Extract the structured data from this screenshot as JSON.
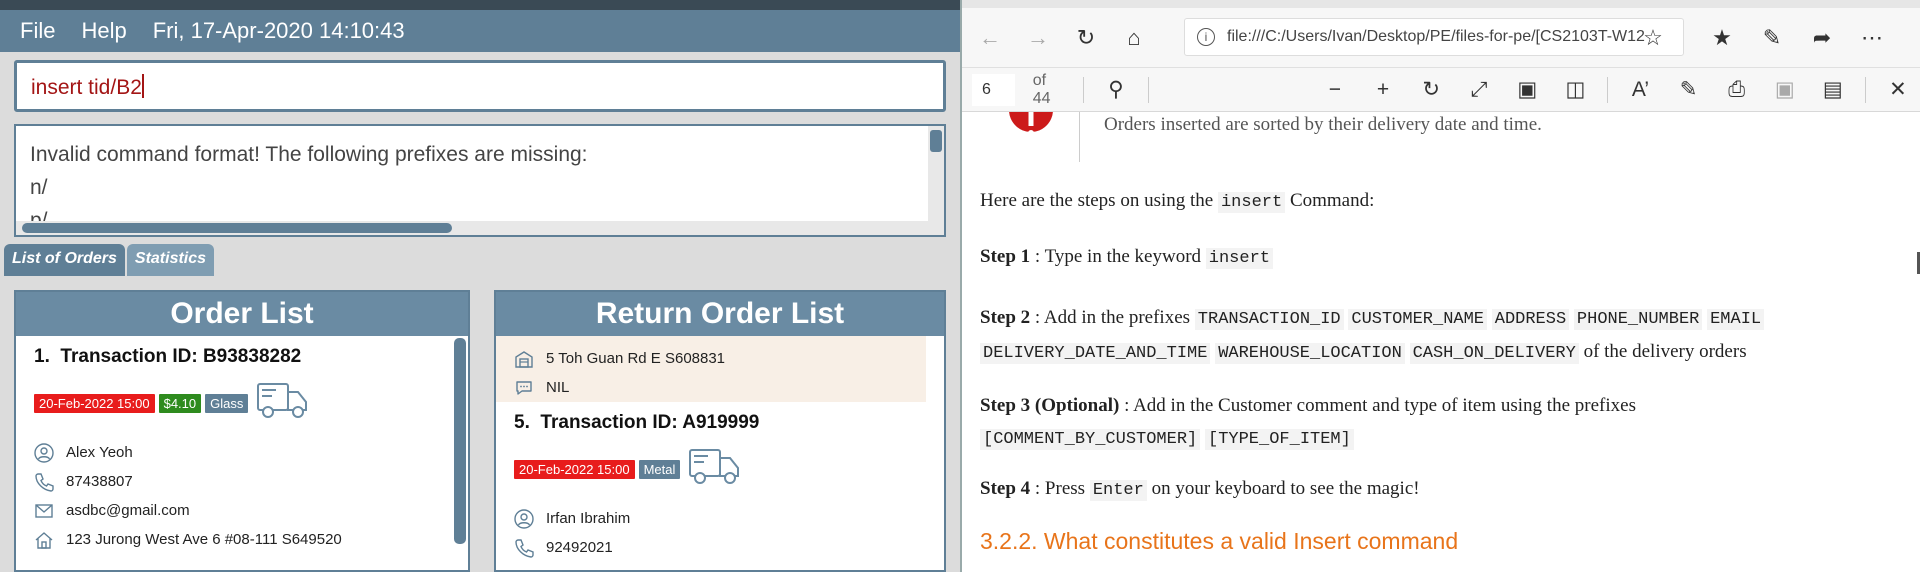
{
  "app": {
    "menu": [
      "File",
      "Help"
    ],
    "datetime": "Fri, 17-Apr-2020 14:10:43",
    "command_input": "insert tid/B2",
    "result_lines": [
      "Invalid command format! The following prefixes are missing:",
      "n/",
      "p/"
    ],
    "tabs": [
      "List of Orders",
      "Statistics"
    ]
  },
  "order_list": {
    "title": "Order List",
    "order": {
      "index": "1.",
      "transaction_label": "Transaction ID: B93838282",
      "date_badge": "20-Feb-2022 15:00",
      "cash_badge": "$4.10",
      "type_badge": "Glass",
      "name": "Alex Yeoh",
      "phone": "87438807",
      "email": "asdbc@gmail.com",
      "address": "123 Jurong West Ave 6 #08-111 S649520"
    }
  },
  "return_list": {
    "title": "Return Order List",
    "prev_warehouse": "5 Toh Guan Rd E S608831",
    "prev_comment": "NIL",
    "order": {
      "index": "5.",
      "transaction_label": "Transaction ID: A919999",
      "date_badge": "20-Feb-2022 15:00",
      "type_badge": "Metal",
      "name": "Irfan Ibrahim",
      "phone": "92492021"
    }
  },
  "browser": {
    "url": "file:///C:/Users/Ivan/Desktop/PE/files-for-pe/[CS2103T-W12",
    "page_number": "6",
    "page_total": "of 44"
  },
  "document": {
    "note_text": "Orders inserted are sorted by their delivery date and time.",
    "intro_prefix": "Here are the steps on using the ",
    "intro_code": "insert",
    "intro_suffix": " Command:",
    "step1_label": "Step 1",
    "step1_text": " : Type in the keyword ",
    "step1_code": "insert",
    "step2_label": "Step 2",
    "step2_text": " : Add in the prefixes ",
    "step2_codes": [
      "TRANSACTION_ID",
      "CUSTOMER_NAME",
      "ADDRESS",
      "PHONE_NUMBER",
      "EMAIL",
      "DELIVERY_DATE_AND_TIME",
      "WAREHOUSE_LOCATION",
      "CASH_ON_DELIVERY"
    ],
    "step2_suffix": " of the delivery orders",
    "step3_label": "Step 3",
    "step3_optional": " (Optional)",
    "step3_text": " : Add in the Customer comment and type of item using the prefixes",
    "step3_codes": [
      "[COMMENT_BY_CUSTOMER]",
      "[TYPE_OF_ITEM]"
    ],
    "step4_label": "Step 4",
    "step4_text": " : Press ",
    "step4_code": "Enter",
    "step4_suffix": " on your keyboard to see the magic!",
    "heading": "3.2.2. What constitutes a valid Insert command"
  },
  "colors": {
    "accent": "#5f7f96",
    "date_badge": "#e81c1c",
    "cash_badge": "#2e8b1e",
    "heading": "#e8741a",
    "command_text": "#a31515"
  },
  "icons": [
    "person-icon",
    "phone-icon",
    "mail-icon",
    "home-icon",
    "building-icon",
    "comment-icon",
    "truck-icon"
  ]
}
